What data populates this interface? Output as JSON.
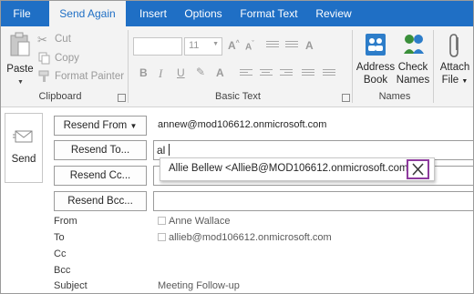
{
  "tabs": [
    "File",
    "Send Again",
    "Insert",
    "Options",
    "Format Text",
    "Review"
  ],
  "clipboard": {
    "paste": "Paste",
    "cut": "Cut",
    "copy": "Copy",
    "format_painter": "Format Painter",
    "group_label": "Clipboard"
  },
  "basic_text": {
    "font_size": "11",
    "bold": "B",
    "italic": "I",
    "group_label": "Basic Text"
  },
  "names": {
    "address_book": [
      "Address",
      "Book"
    ],
    "check_names": [
      "Check",
      "Names"
    ],
    "group_label": "Names"
  },
  "attach": {
    "label": [
      "Attach",
      "File"
    ]
  },
  "compose": {
    "send": "Send",
    "resend_from": "Resend From",
    "from_address": "annew@mod106612.onmicrosoft.com",
    "resend_to": "Resend To...",
    "to_value": "al",
    "resend_cc": "Resend Cc...",
    "resend_bcc": "Resend Bcc...",
    "suggestion": "Allie Bellew <AllieB@MOD106612.onmicrosoft.com>",
    "from_label": "From",
    "from_value": "Anne Wallace",
    "to_label": "To",
    "to_original": "allieb@mod106612.onmicrosoft.com",
    "cc_label": "Cc",
    "bcc_label": "Bcc",
    "subject_label": "Subject",
    "subject_value": "Meeting Follow-up"
  },
  "colors": {
    "tab_bar": "#1f6fc5",
    "ribbon_bg": "#f3f3f3",
    "highlight": "#8e3b9e"
  }
}
